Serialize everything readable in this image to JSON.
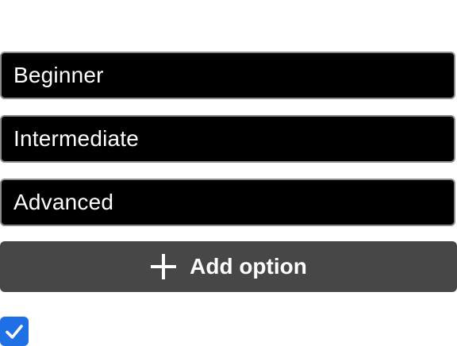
{
  "options": [
    {
      "value": "Beginner"
    },
    {
      "value": "Intermediate"
    },
    {
      "value": "Advanced"
    }
  ],
  "add_button": {
    "label": "Add option",
    "icon": "plus-icon"
  },
  "checkbox": {
    "checked": true,
    "icon": "check-icon",
    "color": "#1f6fe5"
  },
  "colors": {
    "option_bg": "#000000",
    "option_border": "#8a8a8a",
    "button_bg": "#474747",
    "text": "#ffffff"
  }
}
